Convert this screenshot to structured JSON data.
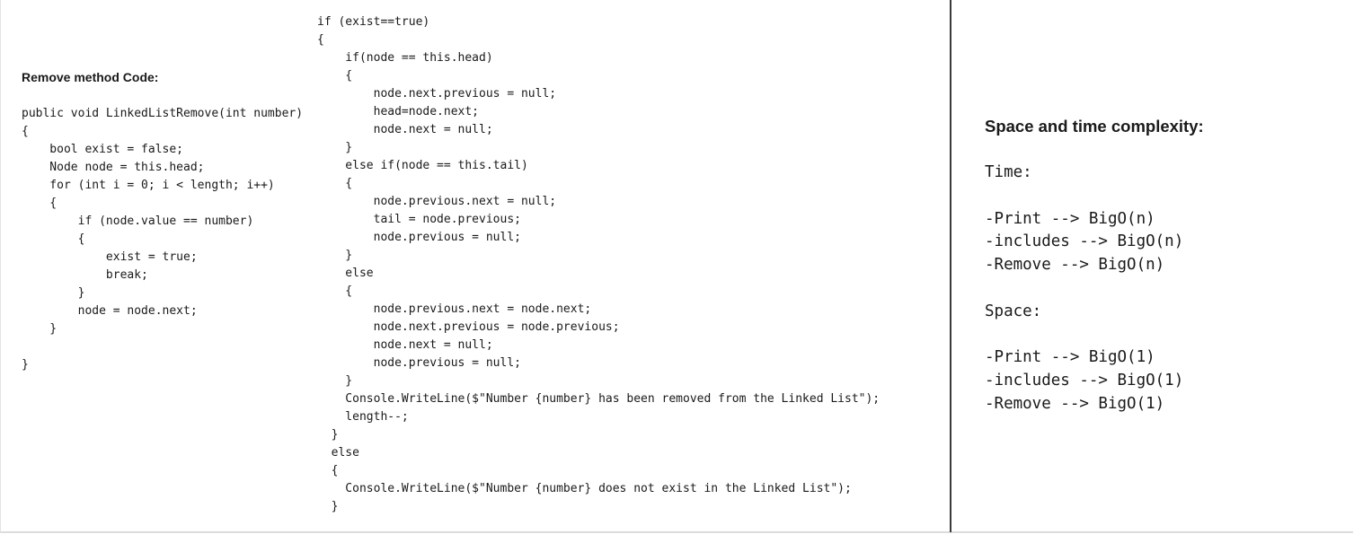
{
  "left_panel": {
    "heading": "Remove method Code:",
    "code_lines": [
      "public void LinkedListRemove(int number)",
      "{",
      "    bool exist = false;",
      "    Node node = this.head;",
      "    for (int i = 0; i < length; i++)",
      "    {",
      "        if (node.value == number)",
      "        {",
      "            exist = true;",
      "            break;",
      "        }",
      "        node = node.next;",
      "    }",
      "",
      "}"
    ]
  },
  "middle_panel": {
    "code_lines": [
      "if (exist==true)",
      "{",
      "    if(node == this.head)",
      "    {",
      "        node.next.previous = null;",
      "        head=node.next;",
      "        node.next = null;",
      "    }",
      "    else if(node == this.tail)",
      "    {",
      "        node.previous.next = null;",
      "        tail = node.previous;",
      "        node.previous = null;",
      "    }",
      "    else",
      "    {",
      "        node.previous.next = node.next;",
      "        node.next.previous = node.previous;",
      "        node.next = null;",
      "        node.previous = null;",
      "    }",
      "    Console.WriteLine($\"Number {number} has been removed from the Linked List\");",
      "    length--;",
      "  }",
      "  else",
      "  {",
      "    Console.WriteLine($\"Number {number} does not exist in the Linked List\");",
      "  }"
    ]
  },
  "right_panel": {
    "heading": "Space and time complexity:",
    "lines": [
      "Time:",
      "",
      "-Print --> BigO(n)",
      "-includes --> BigO(n)",
      "-Remove --> BigO(n)",
      "",
      "Space:",
      "",
      "-Print --> BigO(1)",
      "-includes --> BigO(1)",
      "-Remove --> BigO(1)"
    ]
  }
}
